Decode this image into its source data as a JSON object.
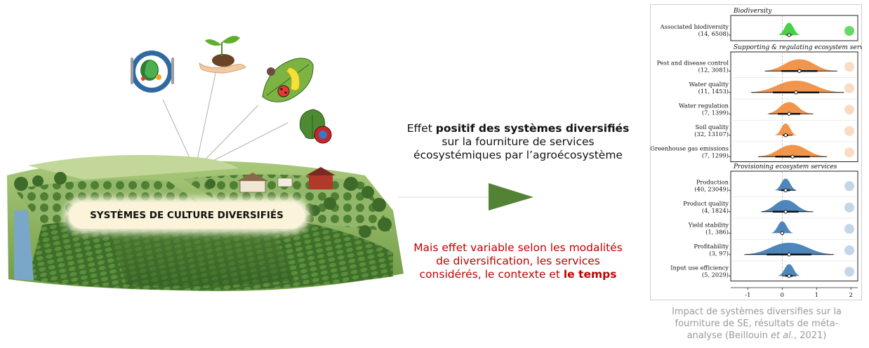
{
  "badge": {
    "label": "SYSTÈMES DE CULTURE DIVERSIFIÉS"
  },
  "message_positive": {
    "line1_prefix": "Effet ",
    "line1_bold": "positif des systèmes diversifiés",
    "line2": "sur la fourniture de services",
    "line3": "écosystémiques par l’agroécosystème"
  },
  "message_variable": {
    "line1": "Mais effet variable selon les modalités",
    "line2": "de diversification, les services",
    "line3_prefix": "considérés, le contexte et ",
    "line3_bold": "le temps"
  },
  "caption": {
    "line1": "Impact de systèmes diversifies sur la",
    "line2": "fourniture de SE, résultats de méta-",
    "line3_prefix": "analyse (Beillouin ",
    "line3_italic": "et al.",
    "line3_suffix": ", 2021)"
  },
  "colors": {
    "arrow": "#548235",
    "biodiversity": "#33cc33",
    "regulating": "#f08a3a",
    "provisioning": "#3b78b2",
    "variable_text": "#c00000",
    "caption_text": "#9a9a9a"
  },
  "chart_data": {
    "type": "scatter",
    "xlim": [
      -1.5,
      2.2
    ],
    "xticks": [
      "-1",
      "0",
      "1",
      "2"
    ],
    "panels": [
      {
        "title": "Biodiversity",
        "color": "#33cc33",
        "rows": [
          {
            "label": "Associated biodiversity",
            "n": "(14, 6508)",
            "estimate": 0.2,
            "ci": [
              0.1,
              0.3
            ],
            "icon": "butterfly-icon"
          }
        ]
      },
      {
        "title": "Supporting & regulating ecosystem services",
        "color": "#f08a3a",
        "rows": [
          {
            "label": "Pest and disease control",
            "n": "(12, 3081)",
            "estimate": 0.5,
            "ci": [
              -0.5,
              1.6
            ],
            "icon": "beetle-icon"
          },
          {
            "label": "Water quality",
            "n": "(11, 1453)",
            "estimate": 0.4,
            "ci": [
              -0.9,
              1.8
            ],
            "icon": "water-drop-icon"
          },
          {
            "label": "Water regulation",
            "n": "(7, 1399)",
            "estimate": 0.2,
            "ci": [
              -0.4,
              0.9
            ],
            "icon": "water-drops-icon"
          },
          {
            "label": "Soil quality",
            "n": "(32, 13107)",
            "estimate": 0.1,
            "ci": [
              0.0,
              0.3
            ],
            "icon": "soil-icon"
          },
          {
            "label": "Greenhouse gas emissions",
            "n": "(7, 1299)",
            "estimate": 0.3,
            "ci": [
              -0.7,
              1.3
            ],
            "icon": "cloud-icon"
          }
        ]
      },
      {
        "title": "Provisioning ecosystem services",
        "color": "#3b78b2",
        "rows": [
          {
            "label": "Production",
            "n": "(40, 23049)",
            "estimate": 0.1,
            "ci": [
              -0.1,
              0.4
            ],
            "icon": "wheat-icon"
          },
          {
            "label": "Product quality",
            "n": "(4, 1824)",
            "estimate": 0.1,
            "ci": [
              -0.6,
              0.9
            ],
            "icon": "apple-icon"
          },
          {
            "label": "Yield stability",
            "n": "(1, 386)",
            "estimate": 0.0,
            "ci": [
              0.0,
              0.0
            ],
            "icon": "stability-chart-icon"
          },
          {
            "label": "Profitability",
            "n": "(3, 97)",
            "estimate": 0.2,
            "ci": [
              -1.1,
              1.5
            ],
            "icon": "banknote-icon"
          },
          {
            "label": "Input use efficiency",
            "n": "(5, 2029)",
            "estimate": 0.2,
            "ci": [
              0.0,
              0.4
            ],
            "icon": "gear-icon"
          }
        ]
      }
    ]
  }
}
